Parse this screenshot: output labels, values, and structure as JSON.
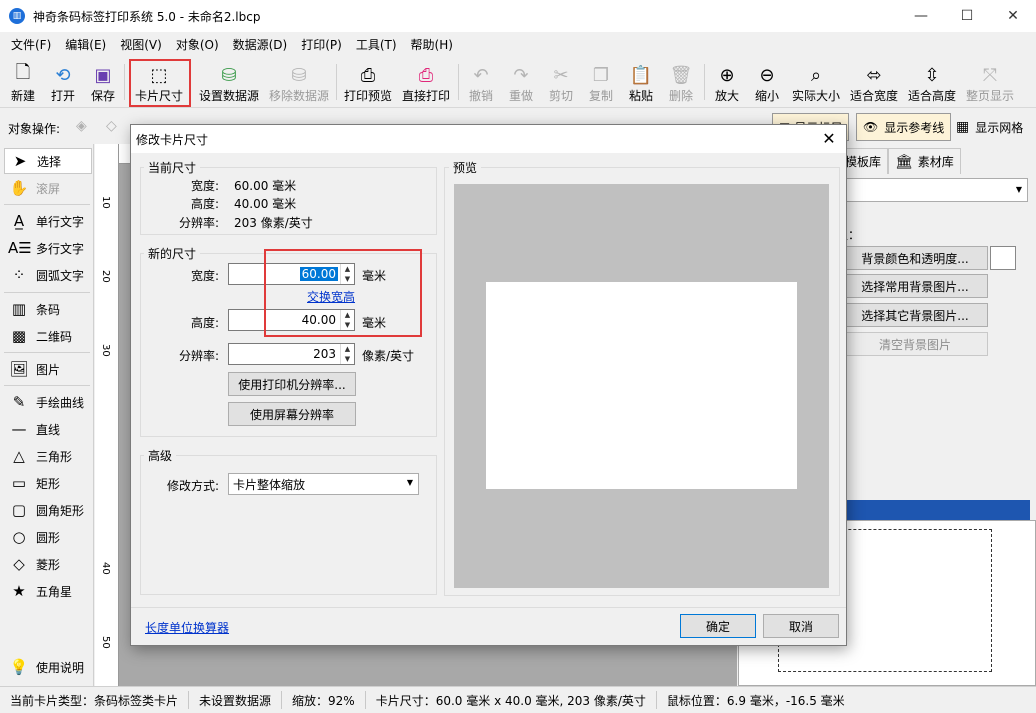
{
  "window": {
    "title": "神奇条码标签打印系统 5.0 - 未命名2.lbcp",
    "minimize": "—",
    "maximize": "☐",
    "close": "✕"
  },
  "menu": [
    "文件(F)",
    "编辑(E)",
    "视图(V)",
    "对象(O)",
    "数据源(D)",
    "打印(P)",
    "工具(T)",
    "帮助(H)"
  ],
  "toolbar": {
    "new": "新建",
    "open": "打开",
    "save": "保存",
    "card_size": "卡片尺寸",
    "set_datasource": "设置数据源",
    "remove_datasource": "移除数据源",
    "print_preview": "打印预览",
    "direct_print": "直接打印",
    "undo": "撤销",
    "redo": "重做",
    "cut": "剪切",
    "copy": "复制",
    "paste": "粘贴",
    "delete": "删除",
    "zoom_in": "放大",
    "zoom_out": "缩小",
    "actual_size": "实际大小",
    "fit_width": "适合宽度",
    "fit_height": "适合高度",
    "fit_page": "整页显示"
  },
  "objbar": {
    "label": "对象操作:",
    "show_ruler": "显示标尺",
    "show_guides": "显示参考线",
    "show_grid": "显示网格"
  },
  "tools": {
    "select": "选择",
    "scroll": "滚屏",
    "single_text": "单行文字",
    "multi_text": "多行文字",
    "arc_text": "圆弧文字",
    "barcode": "条码",
    "qrcode": "二维码",
    "image": "图片",
    "freehand": "手绘曲线",
    "line": "直线",
    "triangle": "三角形",
    "rectangle": "矩形",
    "round_rect": "圆角矩形",
    "circle": "圆形",
    "diamond": "菱形",
    "star": "五角星",
    "help": "使用说明"
  },
  "ruler_marks": [
    "10",
    "20",
    "30",
    "40",
    "50"
  ],
  "rightpanel": {
    "tab_templates": "模板库",
    "tab_materials": "素材库",
    "section_label": "生：",
    "btn_bg_color": "背景颜色和透明度...",
    "btn_common_bg": "选择常用背景图片...",
    "btn_other_bg": "选择其它背景图片...",
    "btn_clear_bg": "清空背景图片"
  },
  "dialog": {
    "title": "修改卡片尺寸",
    "current_group": "当前尺寸",
    "current_width_label": "宽度:",
    "current_width": "60.00 毫米",
    "current_height_label": "高度:",
    "current_height": "40.00 毫米",
    "current_dpi_label": "分辨率:",
    "current_dpi": "203 像素/英寸",
    "new_group": "新的尺寸",
    "width_label": "宽度:",
    "width_value": "60.00",
    "height_label": "高度:",
    "height_value": "40.00",
    "unit_mm": "毫米",
    "swap_link": "交换宽高",
    "dpi_label": "分辨率:",
    "dpi_value": "203",
    "dpi_unit": "像素/英寸",
    "btn_printer_dpi": "使用打印机分辨率...",
    "btn_screen_dpi": "使用屏幕分辨率",
    "advanced_group": "高级",
    "mode_label": "修改方式:",
    "mode_value": "卡片整体缩放",
    "preview_group": "预览",
    "unit_calc_link": "长度单位换算器",
    "ok": "确定",
    "cancel": "取消"
  },
  "status": {
    "card_type": "当前卡片类型：条码标签类卡片",
    "datasource": "未设置数据源",
    "zoom": "缩放：92%",
    "card_size": "卡片尺寸：60.0 毫米 x 40.0 毫米, 203 像素/英寸",
    "mouse_pos": "鼠标位置：6.9 毫米，-16.5 毫米"
  }
}
